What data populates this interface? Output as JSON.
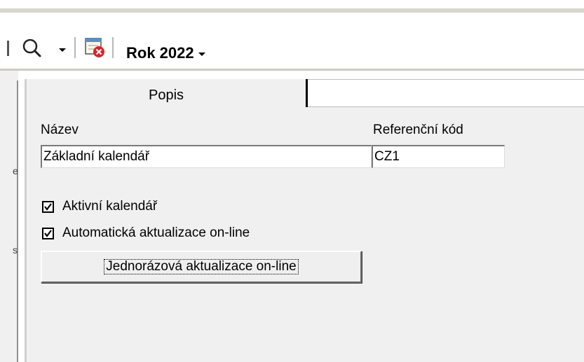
{
  "toolbar": {
    "search_icon": "magnifier-icon",
    "close_calendar_icon": "calendar-close-icon",
    "year_label": "Rok 2022"
  },
  "tabs": [
    {
      "label": "Popis",
      "active": true
    },
    {
      "label": "",
      "active": false
    }
  ],
  "form": {
    "name_label": "Název",
    "name_value": "Základní kalendář",
    "ref_label": "Referenční kód",
    "ref_value": "CZ1",
    "active_label": "Aktivní kalendář",
    "active_checked": true,
    "auto_update_label": "Automatická aktualizace on-line",
    "auto_update_checked": true,
    "onetime_button": "Jednorázová aktualizace on-line"
  },
  "left_strip_marks": [
    "e",
    "s"
  ],
  "colors": {
    "panel_bg": "#f0f0f0",
    "close_badge": "#d9232a"
  }
}
